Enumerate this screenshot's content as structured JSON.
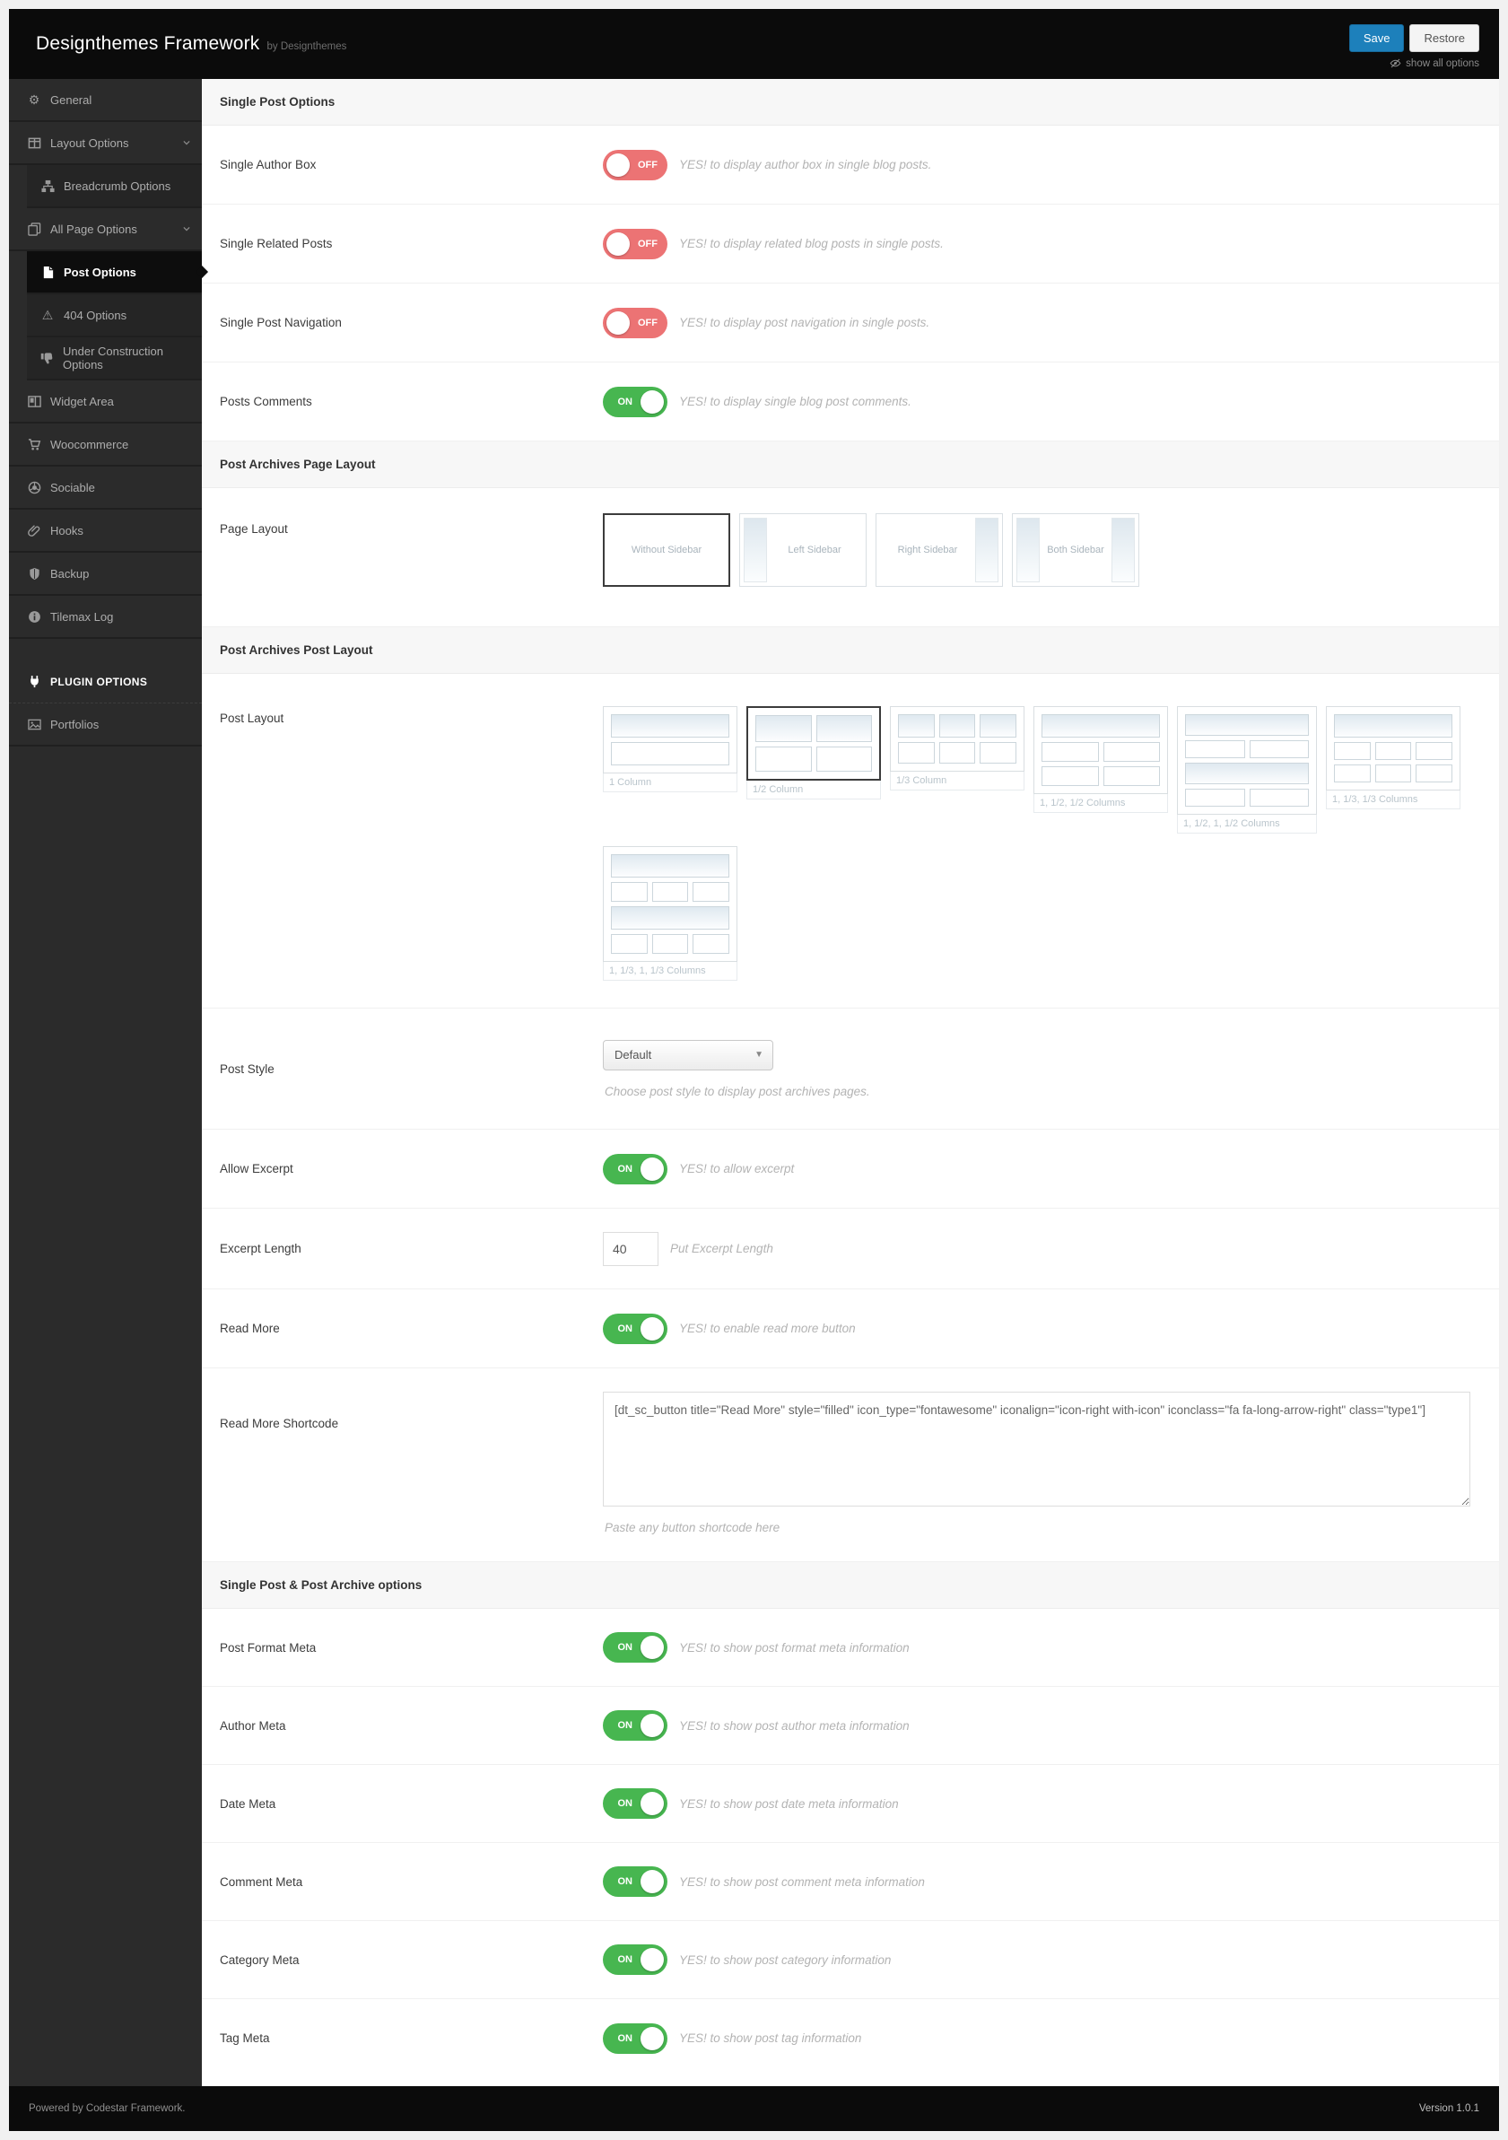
{
  "header": {
    "title": "Designthemes Framework",
    "byline": "by Designthemes",
    "save": "Save",
    "restore": "Restore",
    "show_all": "show all options"
  },
  "sidebar": {
    "items": [
      {
        "label": "General"
      },
      {
        "label": "Layout Options"
      },
      {
        "label": "Breadcrumb Options"
      },
      {
        "label": "All Page Options"
      },
      {
        "label": "Post Options"
      },
      {
        "label": "404 Options"
      },
      {
        "label": "Under Construction Options"
      },
      {
        "label": "Widget Area"
      },
      {
        "label": "Woocommerce"
      },
      {
        "label": "Sociable"
      },
      {
        "label": "Hooks"
      },
      {
        "label": "Backup"
      },
      {
        "label": "Tilemax Log"
      },
      {
        "label": "PLUGIN OPTIONS"
      },
      {
        "label": "Portfolios"
      }
    ]
  },
  "sections": {
    "single_post": {
      "title": "Single Post Options",
      "rows": [
        {
          "label": "Single Author Box",
          "state": "OFF",
          "note": "YES! to display author box in single blog posts."
        },
        {
          "label": "Single Related Posts",
          "state": "OFF",
          "note": "YES! to display related blog posts in single posts."
        },
        {
          "label": "Single Post Navigation",
          "state": "OFF",
          "note": "YES! to display post navigation in single posts."
        },
        {
          "label": "Posts Comments",
          "state": "ON",
          "note": "YES! to display single blog post comments."
        }
      ]
    },
    "page_layout": {
      "title": "Post Archives Page Layout",
      "label": "Page Layout",
      "options": [
        {
          "label": "Without Sidebar"
        },
        {
          "label": "Left Sidebar"
        },
        {
          "label": "Right Sidebar"
        },
        {
          "label": "Both Sidebar"
        }
      ]
    },
    "post_layout": {
      "title": "Post Archives Post Layout",
      "label": "Post Layout",
      "options": [
        {
          "label": "1 Column"
        },
        {
          "label": "1/2 Column"
        },
        {
          "label": "1/3 Column"
        },
        {
          "label": "1, 1/2, 1/2 Columns"
        },
        {
          "label": "1, 1/2, 1, 1/2 Columns"
        },
        {
          "label": "1, 1/3, 1/3 Columns"
        },
        {
          "label": "1, 1/3, 1, 1/3 Columns"
        }
      ]
    },
    "post_style": {
      "label": "Post Style",
      "value": "Default",
      "note": "Choose post style to display post archives pages."
    },
    "allow_excerpt": {
      "label": "Allow Excerpt",
      "state": "ON",
      "note": "YES! to allow excerpt"
    },
    "excerpt_length": {
      "label": "Excerpt Length",
      "value": "40",
      "note": "Put Excerpt Length"
    },
    "read_more": {
      "label": "Read More",
      "state": "ON",
      "note": "YES! to enable read more button"
    },
    "read_more_shortcode": {
      "label": "Read More Shortcode",
      "value": "[dt_sc_button title=\"Read More\" style=\"filled\" icon_type=\"fontawesome\" iconalign=\"icon-right with-icon\" iconclass=\"fa fa-long-arrow-right\" class=\"type1\"]",
      "note": "Paste any button shortcode here"
    },
    "meta": {
      "title": "Single Post & Post Archive options",
      "rows": [
        {
          "label": "Post Format Meta",
          "state": "ON",
          "note": "YES! to show post format meta information"
        },
        {
          "label": "Author Meta",
          "state": "ON",
          "note": "YES! to show post author meta information"
        },
        {
          "label": "Date Meta",
          "state": "ON",
          "note": "YES! to show post date meta information"
        },
        {
          "label": "Comment Meta",
          "state": "ON",
          "note": "YES! to show post comment meta information"
        },
        {
          "label": "Category Meta",
          "state": "ON",
          "note": "YES! to show post category information"
        },
        {
          "label": "Tag Meta",
          "state": "ON",
          "note": "YES! to show post tag information"
        }
      ]
    }
  },
  "footer": {
    "powered": "Powered by Codestar Framework.",
    "version": "Version 1.0.1"
  }
}
